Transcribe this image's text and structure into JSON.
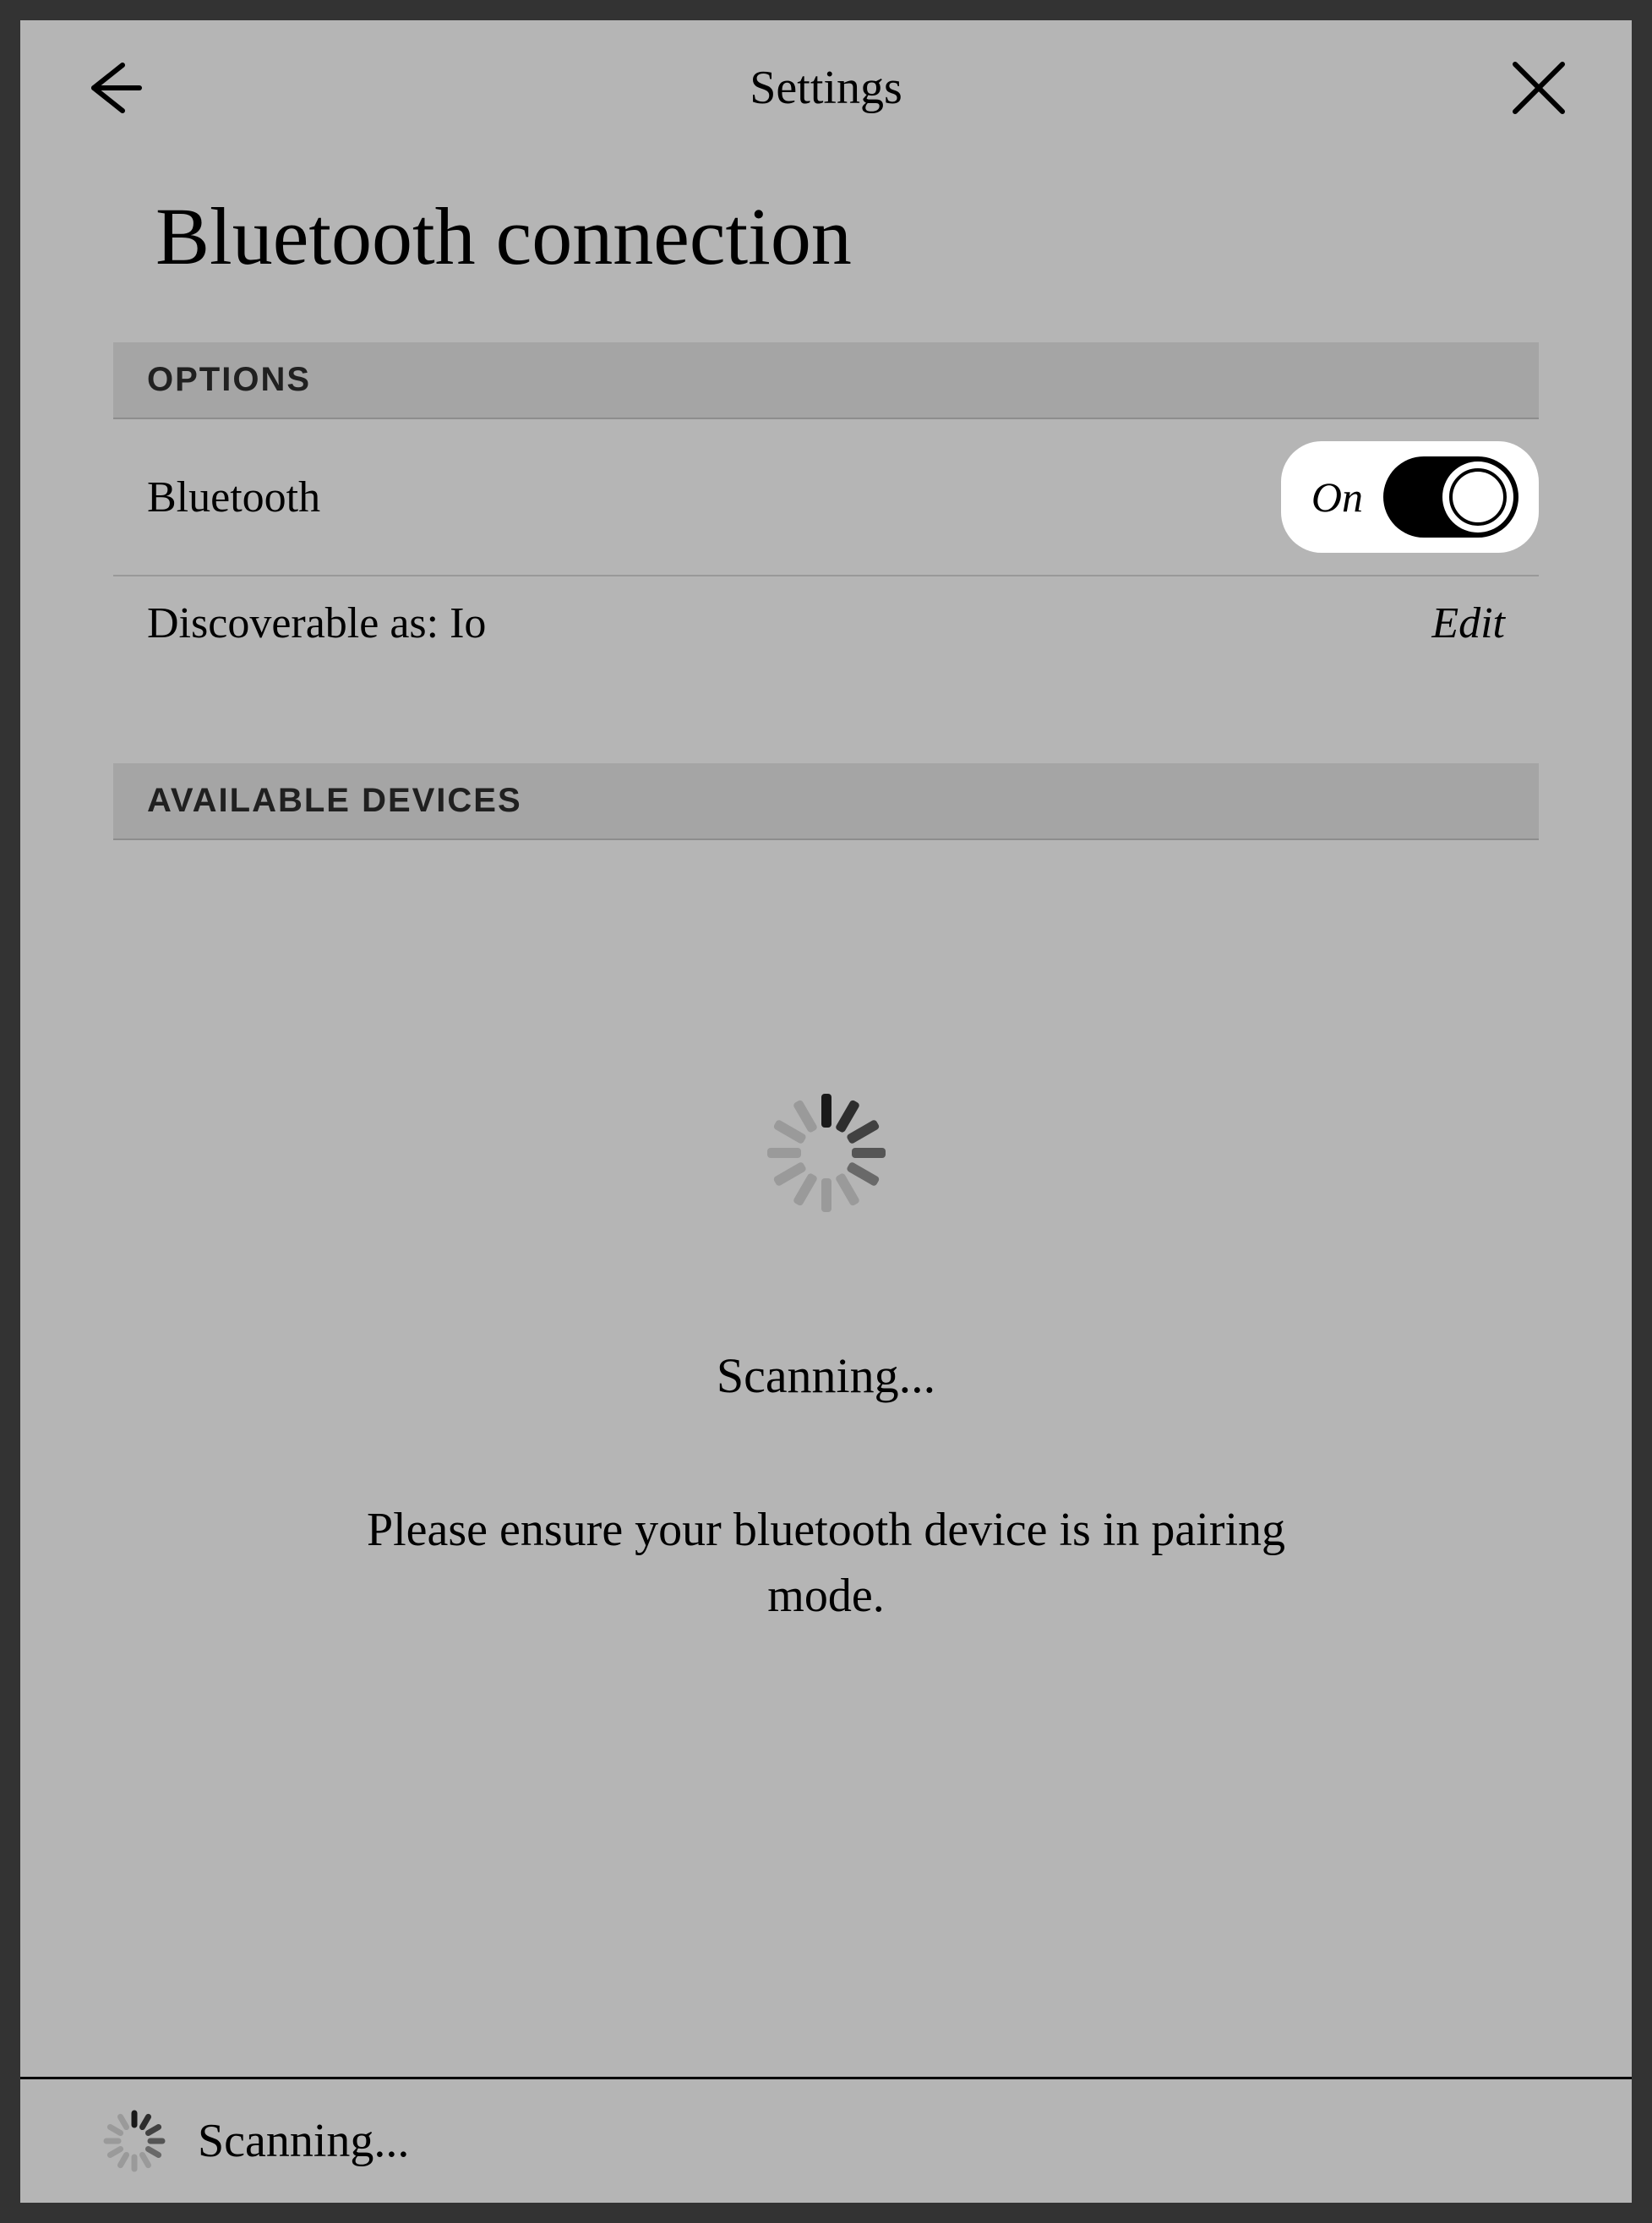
{
  "header": {
    "title": "Settings"
  },
  "page": {
    "title": "Bluetooth connection"
  },
  "sections": {
    "options_header": "OPTIONS",
    "bluetooth_row": {
      "label": "Bluetooth",
      "toggle_state_label": "On",
      "toggle_on": true
    },
    "discoverable_row": {
      "label": "Discoverable as: Io",
      "action": "Edit"
    },
    "available_header": "AVAILABLE DEVICES"
  },
  "scanning": {
    "title": "Scanning...",
    "message": "Please ensure your bluetooth device is in pairing mode."
  },
  "footer": {
    "status": "Scanning..."
  }
}
